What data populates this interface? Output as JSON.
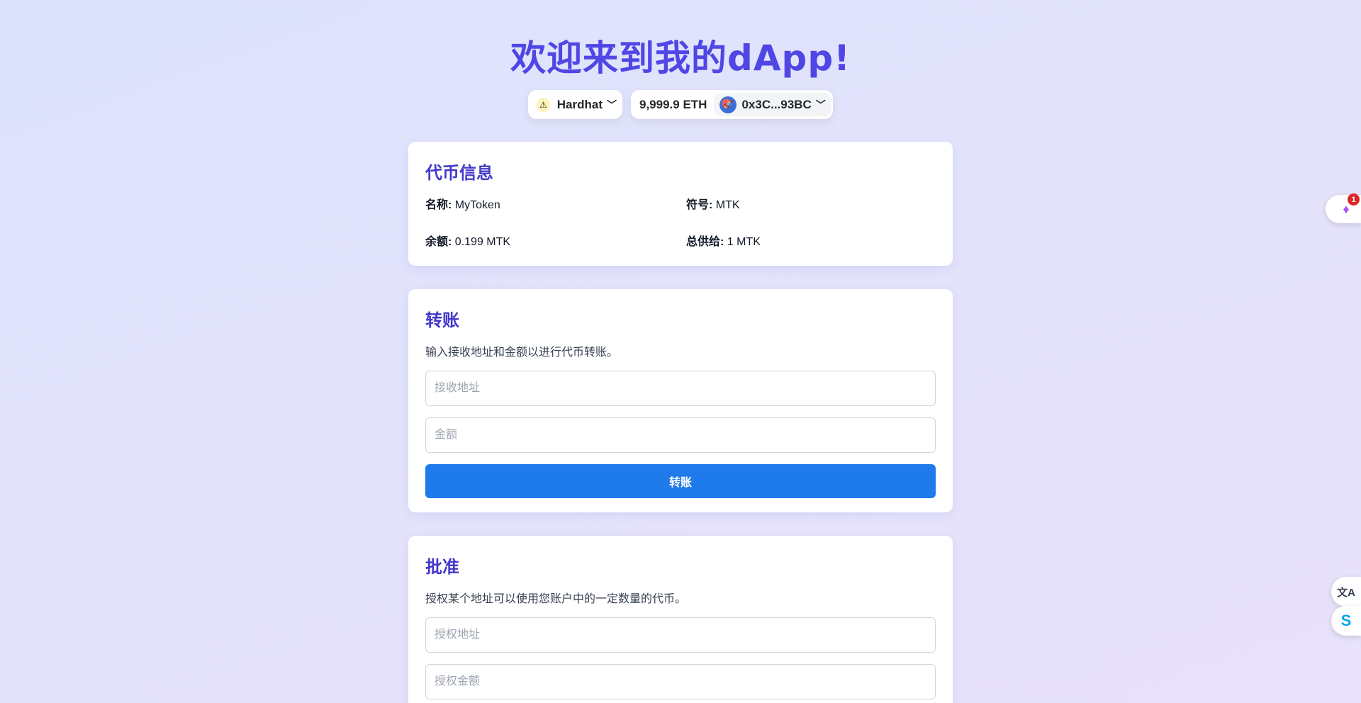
{
  "header": {
    "title": "欢迎来到我的dApp!"
  },
  "wallet": {
    "chain_name": "Hardhat",
    "balance": "9,999.9 ETH",
    "address": "0x3C...93BC"
  },
  "token_info": {
    "title": "代币信息",
    "name_label": "名称:",
    "name_value": "MyToken",
    "symbol_label": "符号:",
    "symbol_value": "MTK",
    "balance_label": "余额:",
    "balance_value": "0.199 MTK",
    "supply_label": "总供给:",
    "supply_value": "1 MTK"
  },
  "transfer": {
    "title": "转账",
    "description": "输入接收地址和金额以进行代币转账。",
    "address_placeholder": "接收地址",
    "amount_placeholder": "金额",
    "button_label": "转账"
  },
  "approve": {
    "title": "批准",
    "description": "授权某个地址可以使用您账户中的一定数量的代币。",
    "address_placeholder": "授权地址",
    "amount_placeholder": "授权金额"
  },
  "side_widgets": {
    "extension_badge": "1"
  }
}
